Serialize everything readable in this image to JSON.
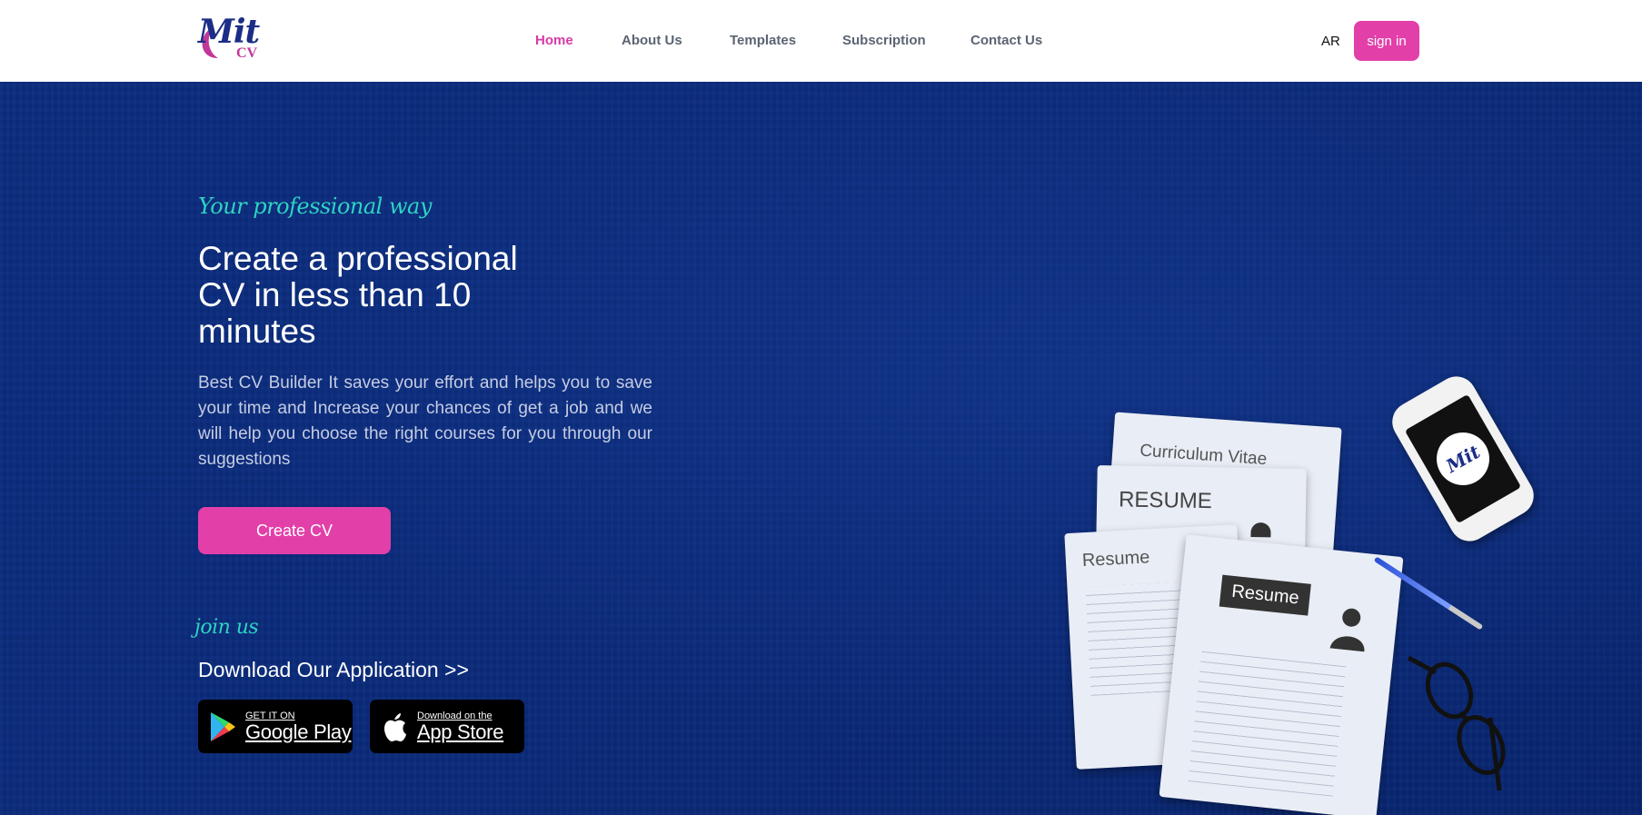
{
  "logo": {
    "main": "Mit",
    "sub": "CV"
  },
  "nav": [
    {
      "label": "Home",
      "active": true
    },
    {
      "label": "About Us",
      "active": false
    },
    {
      "label": "Templates",
      "active": false
    },
    {
      "label": "Subscription",
      "active": false
    },
    {
      "label": "Contact Us",
      "active": false
    }
  ],
  "header": {
    "lang": "AR",
    "signin": "sign in"
  },
  "hero": {
    "tagline": "Your professional way",
    "headline": "Create a professional CV in less than 10 minutes",
    "description": "Best CV Builder It saves your effort and helps you to save your time and Increase your chances of get a job and we will help you choose the right courses for you through our suggestions",
    "create_button": "Create CV",
    "join_label": "join us",
    "download_label": "Download Our Application >>"
  },
  "stores": {
    "google": {
      "small": "GET IT ON",
      "big": "Google Play"
    },
    "apple": {
      "small": "Download on the",
      "big": "App Store"
    }
  },
  "illustration": {
    "paper1": "Curriculum Vitae",
    "paper2": "RESUME",
    "paper3": "Resume",
    "paper4": "Resume",
    "phone_logo": "Mit"
  },
  "colors": {
    "brand_pink": "#e23fa9",
    "brand_navy": "#1b2d86",
    "accent_teal": "#2ed3c3",
    "hero_bg": "#0a2a78"
  }
}
